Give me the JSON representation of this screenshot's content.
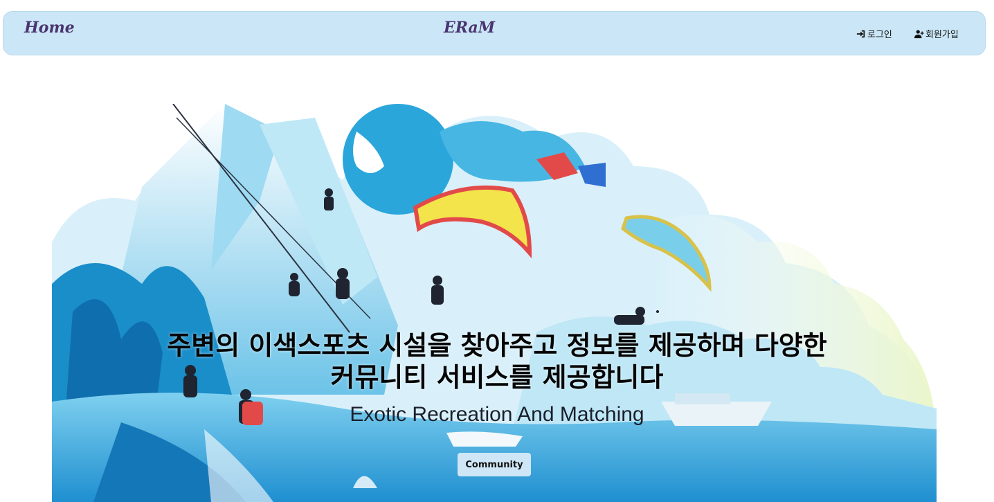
{
  "nav": {
    "home_label": "Home",
    "brand_label": "ERaM",
    "login_label": "로그인",
    "signup_label": "회원가입",
    "login_icon": "sign-in-icon",
    "signup_icon": "user-plus-icon"
  },
  "hero": {
    "headline_line1": "주변의 이색스포츠 시설을 찾아주고 정보를 제공하며 다양한",
    "headline_line2": "커뮤니티 서비스를 제공합니다",
    "subtitle": "Exotic Recreation And Matching",
    "community_button": "Community"
  },
  "colors": {
    "navbar_bg": "#cbe7f7",
    "brand_text": "#4a3470",
    "button_bg": "#cfe6f6",
    "sky_blue": "#2aa6db",
    "paraglider_yellow": "#f2e44a",
    "paraglider_red": "#e24a4a"
  }
}
